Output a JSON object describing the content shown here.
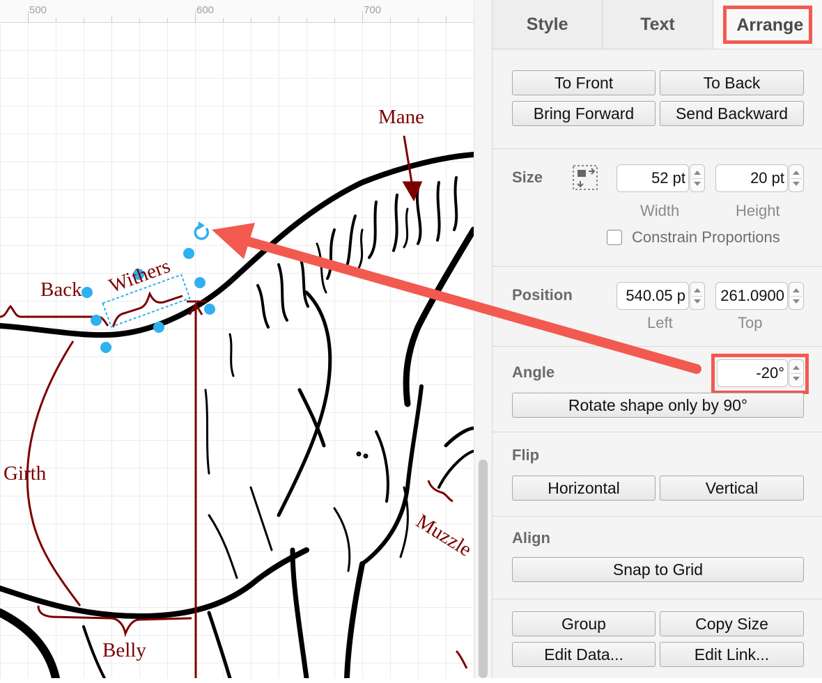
{
  "ruler": {
    "labels": [
      "500",
      "600",
      "700"
    ]
  },
  "canvas_labels": {
    "mane": "Mane",
    "back": "Back",
    "withers": "Withers",
    "girth": "Girth",
    "belly": "Belly",
    "muzzle": "Muzzle"
  },
  "panel": {
    "tabs": [
      "Style",
      "Text",
      "Arrange"
    ],
    "active_tab": "Arrange",
    "order": {
      "to_front": "To Front",
      "to_back": "To Back",
      "bring_forward": "Bring Forward",
      "send_backward": "Send Backward"
    },
    "size": {
      "title": "Size",
      "width_value": "52 pt",
      "height_value": "20 pt",
      "width_label": "Width",
      "height_label": "Height",
      "constrain_label": "Constrain Proportions",
      "constrain_checked": false
    },
    "position": {
      "title": "Position",
      "left_value": "540.05 p",
      "top_value": "261.0900",
      "left_label": "Left",
      "top_label": "Top"
    },
    "angle": {
      "title": "Angle",
      "value": "-20°",
      "rotate_button": "Rotate shape only by 90°"
    },
    "flip": {
      "title": "Flip",
      "horizontal": "Horizontal",
      "vertical": "Vertical"
    },
    "align": {
      "title": "Align",
      "snap": "Snap to Grid"
    },
    "misc": {
      "group": "Group",
      "copy_size": "Copy Size",
      "edit_data": "Edit Data...",
      "edit_link": "Edit Link..."
    }
  },
  "colors": {
    "annotation": "#f25a50",
    "label_text": "#7b0000",
    "selection_handle": "#2fb0ef"
  }
}
